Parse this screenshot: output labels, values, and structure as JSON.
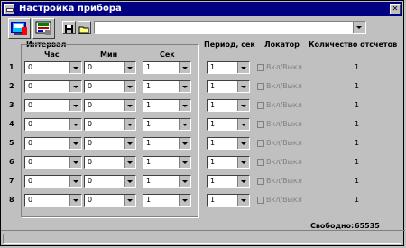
{
  "window": {
    "title": "Настройка прибора"
  },
  "toolbar": {
    "big_buttons": [
      "device-settings-icon",
      "device-connect-icon"
    ],
    "small_buttons": [
      "save-icon",
      "open-folder-icon"
    ],
    "combo_value": ""
  },
  "headers": {
    "interval": "Интервал",
    "hour": "Час",
    "min": "Мин",
    "sec": "Сек",
    "period": "Период, сек",
    "locator": "Локатор",
    "count": "Количество отсчетов"
  },
  "rows": [
    {
      "num": "1",
      "hour": "0",
      "min": "0",
      "sec": "1",
      "period": "1",
      "locator": "Вкл/Выкл",
      "count": "1"
    },
    {
      "num": "2",
      "hour": "0",
      "min": "0",
      "sec": "1",
      "period": "1",
      "locator": "Вкл/Выкл",
      "count": "1"
    },
    {
      "num": "3",
      "hour": "0",
      "min": "0",
      "sec": "1",
      "period": "1",
      "locator": "Вкл/Выкл",
      "count": "1"
    },
    {
      "num": "4",
      "hour": "0",
      "min": "0",
      "sec": "1",
      "period": "1",
      "locator": "Вкл/Выкл",
      "count": "1"
    },
    {
      "num": "5",
      "hour": "0",
      "min": "0",
      "sec": "1",
      "period": "1",
      "locator": "Вкл/Выкл",
      "count": "1"
    },
    {
      "num": "6",
      "hour": "0",
      "min": "0",
      "sec": "1",
      "period": "1",
      "locator": "Вкл/Выкл",
      "count": "1"
    },
    {
      "num": "7",
      "hour": "0",
      "min": "0",
      "sec": "1",
      "period": "1",
      "locator": "Вкл/Выкл",
      "count": "1"
    },
    {
      "num": "8",
      "hour": "0",
      "min": "0",
      "sec": "1",
      "period": "1",
      "locator": "Вкл/Выкл",
      "count": "1"
    }
  ],
  "footer": {
    "free_label": "Свободно:",
    "free_value": "65535"
  }
}
